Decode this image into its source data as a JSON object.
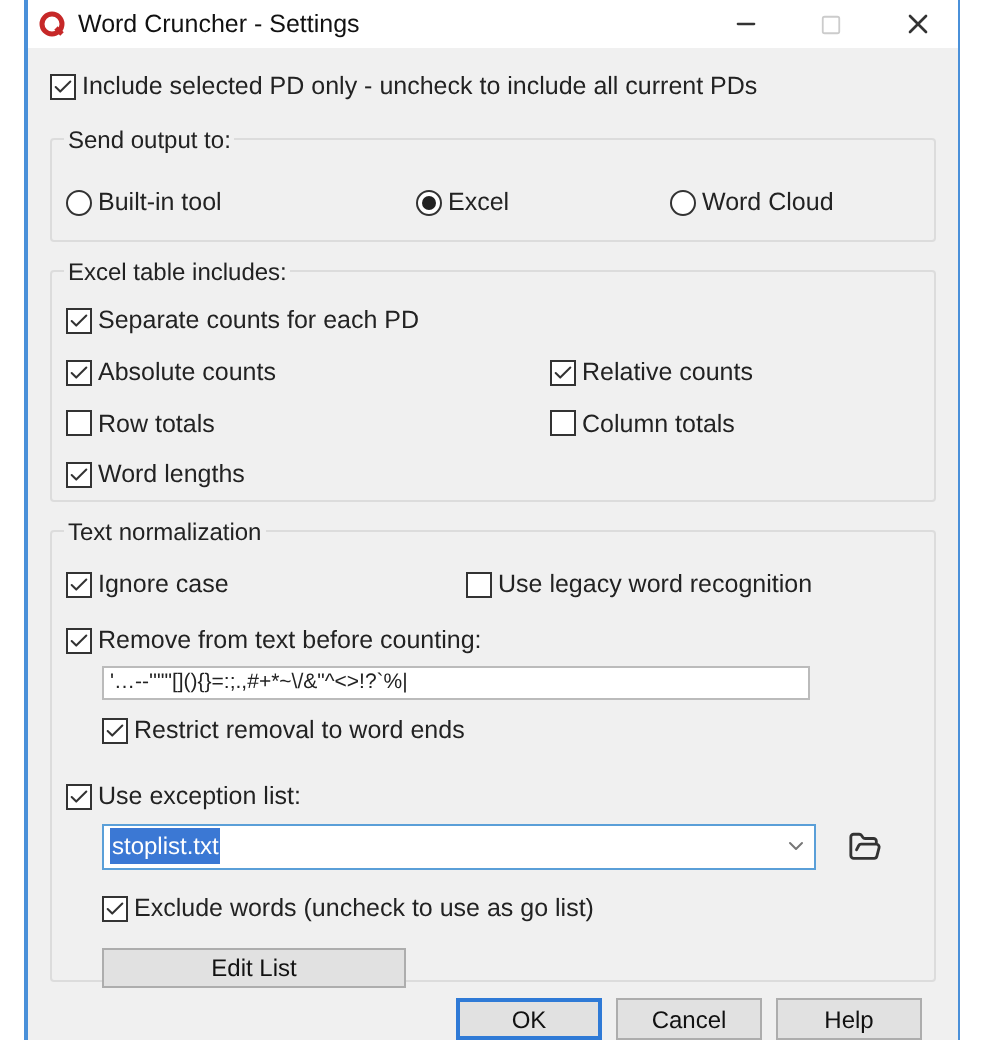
{
  "window": {
    "title": "Word Cruncher - Settings"
  },
  "include_selected": {
    "label": "Include selected PD only - uncheck to include all current PDs",
    "checked": true
  },
  "send_output": {
    "title": "Send output to:",
    "options": [
      {
        "label": "Built-in tool",
        "selected": false
      },
      {
        "label": "Excel",
        "selected": true
      },
      {
        "label": "Word Cloud",
        "selected": false
      }
    ]
  },
  "excel_table": {
    "title": "Excel table includes:",
    "rows": [
      [
        {
          "label": "Separate counts for each PD",
          "checked": true
        }
      ],
      [
        {
          "label": "Absolute counts",
          "checked": true
        },
        {
          "label": "Relative counts",
          "checked": true
        }
      ],
      [
        {
          "label": "Row totals",
          "checked": false
        },
        {
          "label": "Column totals",
          "checked": false
        }
      ],
      [
        {
          "label": "Word lengths",
          "checked": true
        }
      ]
    ]
  },
  "text_normalization": {
    "title": "Text normalization",
    "ignore_case": {
      "label": "Ignore case",
      "checked": true
    },
    "legacy": {
      "label": "Use legacy word recognition",
      "checked": false
    },
    "remove": {
      "label": "Remove from text before counting:",
      "checked": true,
      "value": "'…--''\"\"[](){}=:;.,#+*~\\/&\"^<>!?`%|"
    },
    "restrict": {
      "label": "Restrict removal to word ends",
      "checked": true
    },
    "exception": {
      "label": "Use exception list:",
      "checked": true,
      "value": "stoplist.txt"
    },
    "exclude": {
      "label": "Exclude words (uncheck to use as go list)",
      "checked": true
    },
    "edit_button": "Edit List"
  },
  "buttons": [
    {
      "label": "OK",
      "default": true
    },
    {
      "label": "Cancel",
      "default": false
    },
    {
      "label": "Help",
      "default": false
    }
  ]
}
